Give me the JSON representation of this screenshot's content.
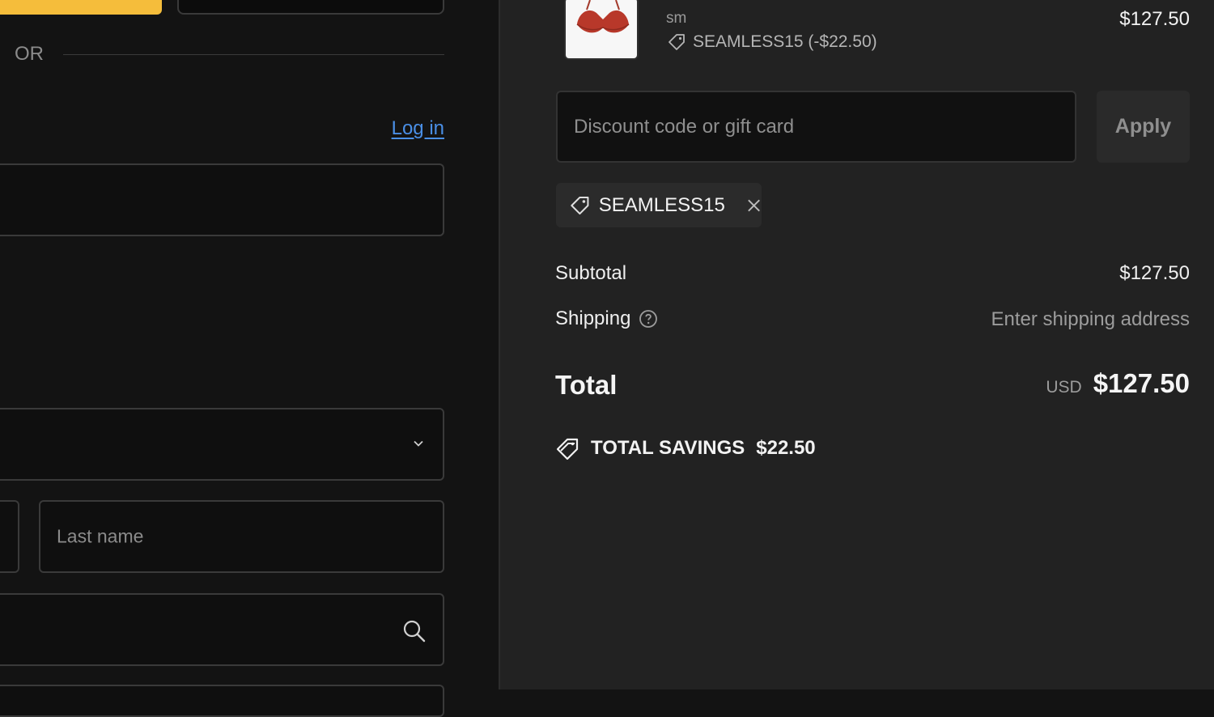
{
  "left": {
    "or_text": "OR",
    "login_link": "Log in",
    "last_name_placeholder": "Last name"
  },
  "order": {
    "variant": "sm",
    "line_discount": "SEAMLESS15 (-$22.50)",
    "line_price": "$127.50"
  },
  "discount": {
    "placeholder": "Discount code or gift card",
    "apply_label": "Apply",
    "applied_code": "SEAMLESS15"
  },
  "summary": {
    "subtotal_label": "Subtotal",
    "subtotal_value": "$127.50",
    "shipping_label": "Shipping",
    "shipping_value": "Enter shipping address",
    "total_label": "Total",
    "currency": "USD",
    "total_value": "$127.50",
    "savings_label": "TOTAL SAVINGS",
    "savings_value": "$22.50"
  },
  "colors": {
    "accent_yellow": "#f5bd3b",
    "link_blue": "#4a8fe6",
    "panel_right": "#222222",
    "panel_left": "#131313"
  },
  "icons": [
    "chevron-down-icon",
    "search-icon",
    "tag-icon",
    "close-icon",
    "help-circle-icon",
    "savings-tag-icon"
  ]
}
